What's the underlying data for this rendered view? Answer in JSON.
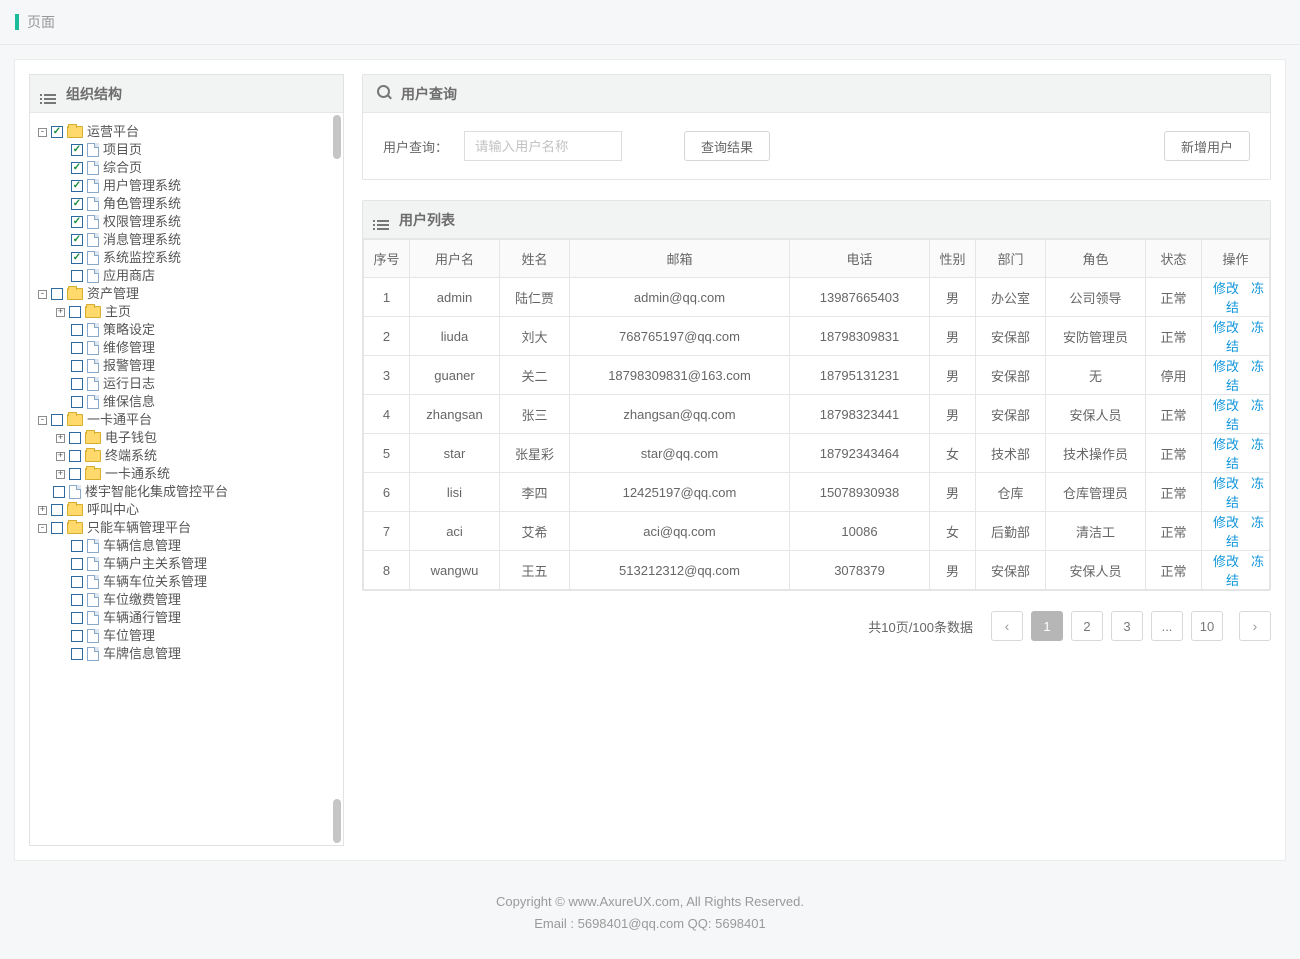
{
  "topbar": {
    "title": "页面"
  },
  "sidebar": {
    "title": "组织结构",
    "tree": [
      {
        "label": "运营平台",
        "type": "folder",
        "toggle": "-",
        "checked": true,
        "children": [
          {
            "label": "项目页",
            "type": "file",
            "checked": true
          },
          {
            "label": "综合页",
            "type": "file",
            "checked": true
          },
          {
            "label": "用户管理系统",
            "type": "file",
            "checked": true
          },
          {
            "label": "角色管理系统",
            "type": "file",
            "checked": true
          },
          {
            "label": "权限管理系统",
            "type": "file",
            "checked": true
          },
          {
            "label": "消息管理系统",
            "type": "file",
            "checked": true
          },
          {
            "label": "系统监控系统",
            "type": "file",
            "checked": true
          },
          {
            "label": "应用商店",
            "type": "file",
            "checked": false
          }
        ]
      },
      {
        "label": "资产管理",
        "type": "folder",
        "toggle": "-",
        "checked": false,
        "children": [
          {
            "label": "主页",
            "type": "folder",
            "toggle": "+",
            "checked": false
          },
          {
            "label": "策略设定",
            "type": "file",
            "checked": false
          },
          {
            "label": "维修管理",
            "type": "file",
            "checked": false
          },
          {
            "label": "报警管理",
            "type": "file",
            "checked": false
          },
          {
            "label": "运行日志",
            "type": "file",
            "checked": false
          },
          {
            "label": "维保信息",
            "type": "file",
            "checked": false
          }
        ]
      },
      {
        "label": "一卡通平台",
        "type": "folder",
        "toggle": "-",
        "checked": false,
        "children": [
          {
            "label": "电子钱包",
            "type": "folder",
            "toggle": "+",
            "checked": false
          },
          {
            "label": "终端系统",
            "type": "folder",
            "toggle": "+",
            "checked": false
          },
          {
            "label": "一卡通系统",
            "type": "folder",
            "toggle": "+",
            "checked": false
          }
        ]
      },
      {
        "label": "楼宇智能化集成管控平台",
        "type": "file",
        "checked": false,
        "top": true
      },
      {
        "label": "呼叫中心",
        "type": "folder",
        "toggle": "+",
        "checked": false,
        "top": true
      },
      {
        "label": "只能车辆管理平台",
        "type": "folder",
        "toggle": "-",
        "checked": false,
        "children": [
          {
            "label": "车辆信息管理",
            "type": "file",
            "checked": false
          },
          {
            "label": "车辆户主关系管理",
            "type": "file",
            "checked": false
          },
          {
            "label": "车辆车位关系管理",
            "type": "file",
            "checked": false
          },
          {
            "label": "车位缴费管理",
            "type": "file",
            "checked": false
          },
          {
            "label": "车辆通行管理",
            "type": "file",
            "checked": false
          },
          {
            "label": "车位管理",
            "type": "file",
            "checked": false
          },
          {
            "label": "车牌信息管理",
            "type": "file",
            "checked": false
          }
        ]
      }
    ]
  },
  "query": {
    "title": "用户查询",
    "label": "用户查询：",
    "placeholder": "请输入用户名称",
    "search_btn": "查询结果",
    "add_btn": "新增用户"
  },
  "table": {
    "title": "用户列表",
    "headers": [
      "序号",
      "用户名",
      "姓名",
      "邮箱",
      "电话",
      "性别",
      "部门",
      "角色",
      "状态",
      "操作"
    ],
    "ops": {
      "edit": "修改",
      "freeze": "冻结"
    },
    "rows": [
      {
        "idx": "1",
        "user": "admin",
        "name": "陆仁贾",
        "email": "admin@qq.com",
        "phone": "13987665403",
        "gender": "男",
        "dept": "办公室",
        "role": "公司领导",
        "status": "正常"
      },
      {
        "idx": "2",
        "user": "liuda",
        "name": "刘大",
        "email": "768765197@qq.com",
        "phone": "18798309831",
        "gender": "男",
        "dept": "安保部",
        "role": "安防管理员",
        "status": "正常"
      },
      {
        "idx": "3",
        "user": "guaner",
        "name": "关二",
        "email": "18798309831@163.com",
        "phone": "18795131231",
        "gender": "男",
        "dept": "安保部",
        "role": "无",
        "status": "停用"
      },
      {
        "idx": "4",
        "user": "zhangsan",
        "name": "张三",
        "email": "zhangsan@qq.com",
        "phone": "18798323441",
        "gender": "男",
        "dept": "安保部",
        "role": "安保人员",
        "status": "正常"
      },
      {
        "idx": "5",
        "user": "star",
        "name": "张星彩",
        "email": "star@qq.com",
        "phone": "18792343464",
        "gender": "女",
        "dept": "技术部",
        "role": "技术操作员",
        "status": "正常"
      },
      {
        "idx": "6",
        "user": "lisi",
        "name": "李四",
        "email": "12425197@qq.com",
        "phone": "15078930938",
        "gender": "男",
        "dept": "仓库",
        "role": "仓库管理员",
        "status": "正常"
      },
      {
        "idx": "7",
        "user": "aci",
        "name": "艾希",
        "email": "aci@qq.com",
        "phone": "10086",
        "gender": "女",
        "dept": "后勤部",
        "role": "清洁工",
        "status": "正常"
      },
      {
        "idx": "8",
        "user": "wangwu",
        "name": "王五",
        "email": "513212312@qq.com",
        "phone": "3078379",
        "gender": "男",
        "dept": "安保部",
        "role": "安保人员",
        "status": "正常"
      }
    ]
  },
  "pager": {
    "info": "共10页/100条数据",
    "pages": [
      "1",
      "2",
      "3",
      "...",
      "10"
    ],
    "active": 0
  },
  "footer": {
    "line1": "Copyright © www.AxureUX.com, All Rights Reserved.",
    "line2": "Email : 5698401@qq.com  QQ: 5698401"
  }
}
